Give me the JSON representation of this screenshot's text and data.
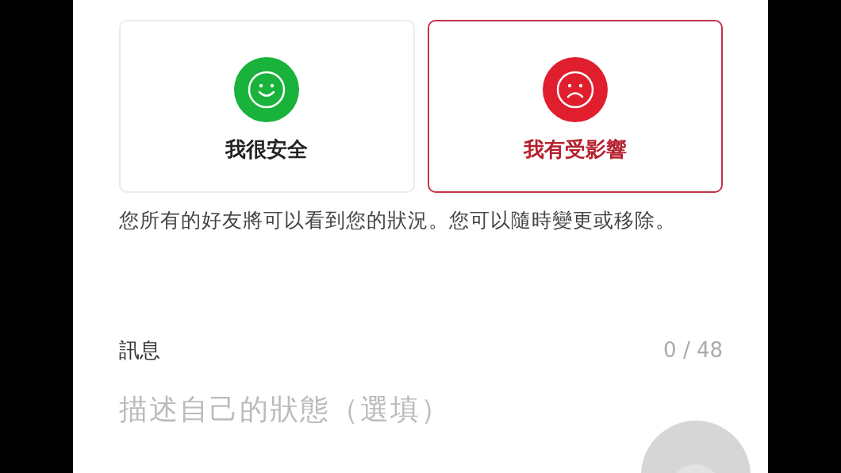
{
  "status_options": [
    {
      "kind": "safe",
      "label": "我很安全",
      "selected": false
    },
    {
      "kind": "affected",
      "label": "我有受影響",
      "selected": true
    }
  ],
  "notice": "您所有的好友將可以看到您的狀況。您可以隨時變更或移除。",
  "message": {
    "label": "訊息",
    "counter": "0 / 48",
    "placeholder": "描述自己的狀態（選填）"
  }
}
